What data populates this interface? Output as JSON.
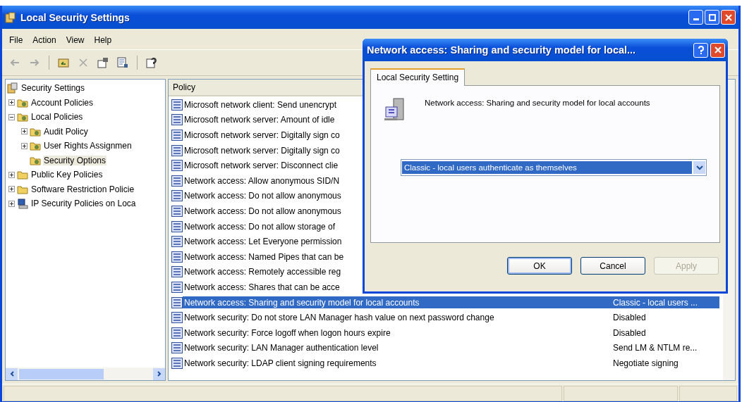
{
  "window": {
    "title": "Local Security Settings"
  },
  "menu": [
    "File",
    "Action",
    "View",
    "Help"
  ],
  "toolbar": [
    {
      "kind": "back",
      "disabled": true
    },
    {
      "kind": "forward",
      "disabled": true
    },
    {
      "kind": "up",
      "disabled": false
    },
    {
      "kind": "delete",
      "disabled": true
    },
    {
      "kind": "properties",
      "disabled": false
    },
    {
      "kind": "export",
      "disabled": false
    },
    {
      "kind": "help",
      "disabled": false
    }
  ],
  "tree": [
    {
      "label": "Security Settings",
      "kind": "root",
      "selected": false,
      "children": [
        {
          "label": "Account Policies",
          "kind": "folder",
          "expanded": false,
          "selected": false
        },
        {
          "label": "Local Policies",
          "kind": "folder",
          "expanded": true,
          "selected": false,
          "children": [
            {
              "label": "Audit Policy",
              "kind": "folder",
              "expanded": false,
              "selected": false
            },
            {
              "label": "User Rights Assignmen",
              "kind": "folder",
              "expanded": false,
              "selected": false
            },
            {
              "label": "Security Options",
              "kind": "folder",
              "selected": true
            }
          ]
        },
        {
          "label": "Public Key Policies",
          "kind": "plainfolder",
          "expanded": false,
          "selected": false
        },
        {
          "label": "Software Restriction Policie",
          "kind": "plainfolder",
          "expanded": false,
          "selected": false
        },
        {
          "label": "IP Security Policies on Loca",
          "kind": "network",
          "expanded": false,
          "selected": false
        }
      ]
    }
  ],
  "list": {
    "columns": [
      "Policy"
    ],
    "rows": [
      {
        "policy": "Microsoft network client: Send unencrypt",
        "selected": false
      },
      {
        "policy": "Microsoft network server: Amount of idle",
        "selected": false
      },
      {
        "policy": "Microsoft network server: Digitally sign co",
        "selected": false
      },
      {
        "policy": "Microsoft network server: Digitally sign co",
        "selected": false
      },
      {
        "policy": "Microsoft network server: Disconnect clie",
        "selected": false
      },
      {
        "policy": "Network access: Allow anonymous SID/N",
        "selected": false
      },
      {
        "policy": "Network access: Do not allow anonymous",
        "selected": false
      },
      {
        "policy": "Network access: Do not allow anonymous",
        "selected": false
      },
      {
        "policy": "Network access: Do not allow storage of",
        "selected": false
      },
      {
        "policy": "Network access: Let Everyone permission",
        "selected": false
      },
      {
        "policy": "Network access: Named Pipes that can be",
        "selected": false
      },
      {
        "policy": "Network access: Remotely accessible reg",
        "selected": false
      },
      {
        "policy": "Network access: Shares that can be acce",
        "selected": false
      },
      {
        "policy": "Network access: Sharing and security model for local accounts",
        "setting": "Classic - local users ...",
        "selected": true
      },
      {
        "policy": "Network security: Do not store LAN Manager hash value on next password change",
        "setting": "Disabled",
        "selected": false
      },
      {
        "policy": "Network security: Force logoff when logon hours expire",
        "setting": "Disabled",
        "selected": false
      },
      {
        "policy": "Network security: LAN Manager authentication level",
        "setting": "Send LM & NTLM re...",
        "selected": false
      },
      {
        "policy": "Network security: LDAP client signing requirements",
        "setting": "Negotiate signing",
        "selected": false
      }
    ]
  },
  "dialog": {
    "title": "Network access: Sharing and security model for local...",
    "tabs": [
      {
        "label": "Local Security Setting",
        "selected": true
      }
    ],
    "description": "Network access: Sharing and security model for local accounts",
    "dropdown": {
      "value": "Classic - local users authenticate as themselves"
    },
    "buttons": [
      {
        "label": "OK",
        "disabled": false,
        "default": true
      },
      {
        "label": "Cancel",
        "disabled": false,
        "default": false
      },
      {
        "label": "Apply",
        "disabled": true,
        "default": false
      }
    ]
  }
}
